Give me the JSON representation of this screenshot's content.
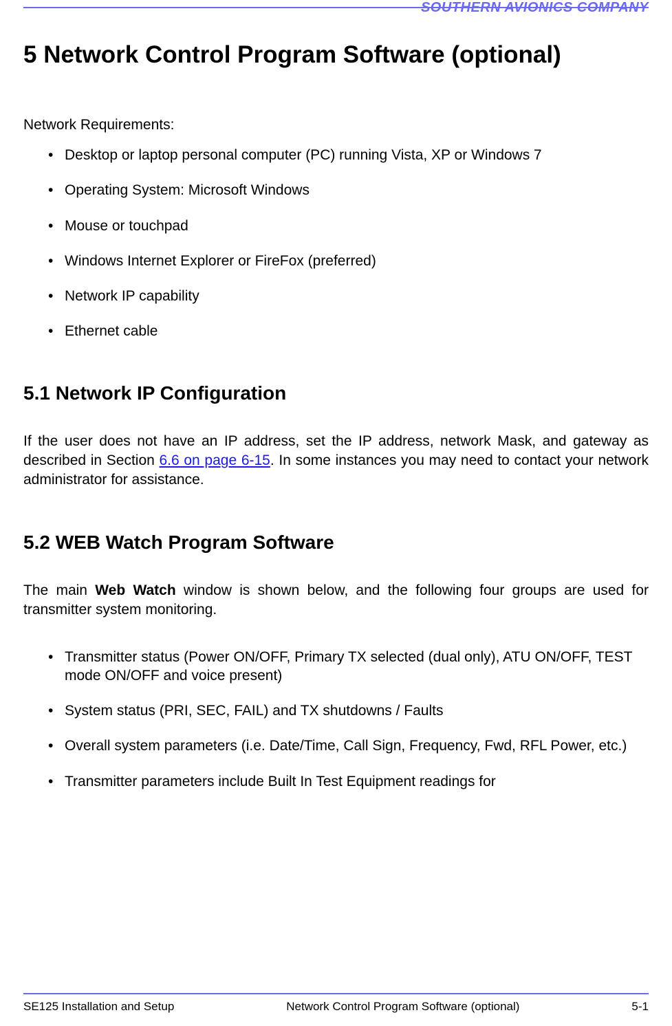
{
  "header": {
    "company": "SOUTHERN AVIONICS COMPANY"
  },
  "title": "5  Network Control Program Software (optional)",
  "intro": "Network Requirements:",
  "requirements": [
    "Desktop or laptop personal computer (PC) running Vista, XP or Windows 7",
    "Operating System: Microsoft Windows",
    "Mouse or touchpad",
    "Windows Internet Explorer or FireFox (preferred)",
    "Network IP capability",
    "Ethernet cable"
  ],
  "section51": {
    "heading": "5.1   Network IP Configuration",
    "para_pre": "If the user does not have an IP address, set the IP address, network Mask, and gateway as described in Section ",
    "link": "6.6 on page 6-15",
    "para_post": ".  In some instances you may need to contact your network administrator for assistance."
  },
  "section52": {
    "heading": "5.2  WEB Watch Program Software",
    "para_pre": "The main ",
    "bold": "Web Watch",
    "para_post": " window is shown below, and the following four groups are used for transmitter system monitoring.",
    "bullets": [
      "Transmitter status (Power ON/OFF, Primary TX selected (dual only), ATU ON/OFF, TEST mode ON/OFF and voice present)",
      "System status (PRI, SEC, FAIL) and TX shutdowns / Faults",
      "Overall system parameters (i.e. Date/Time, Call Sign, Frequency, Fwd, RFL Power, etc.)",
      "Transmitter parameters include Built In Test Equipment readings for"
    ]
  },
  "footer": {
    "left": "SE125 Installation and Setup",
    "center": "Network Control Program Software (optional)",
    "right": "5-1"
  }
}
